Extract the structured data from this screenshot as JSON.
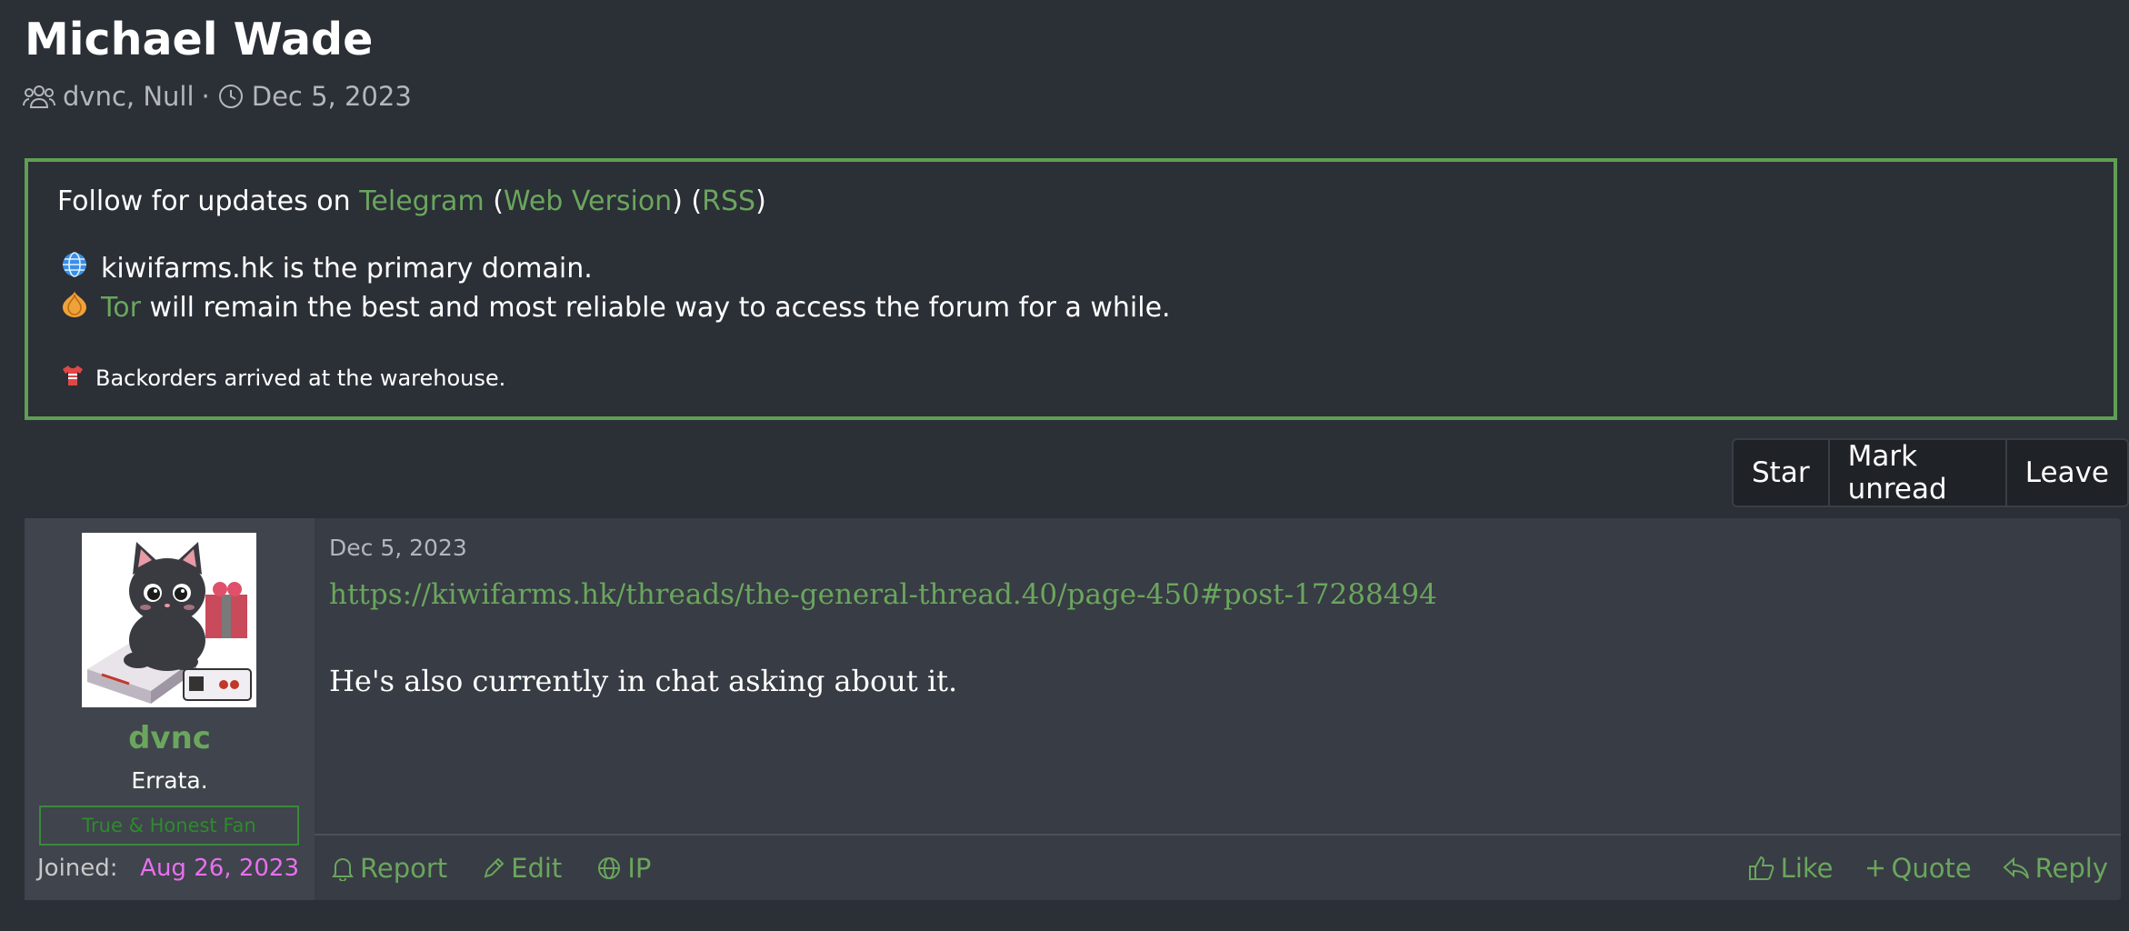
{
  "thread": {
    "title": "Michael Wade",
    "participants": "dvnc, Null",
    "separator": "·",
    "date": "Dec 5, 2023"
  },
  "notice": {
    "follow_prefix": "Follow for updates on ",
    "telegram": "Telegram",
    "open1": " (",
    "web_version": "Web Version",
    "mid": ") (",
    "rss": "RSS",
    "close": ")",
    "domain_text": "kiwifarms.hk is the primary domain.",
    "tor": "Tor",
    "tor_text": " will remain the best and most reliable way to access the forum for a while.",
    "backorders": "Backorders arrived at the warehouse."
  },
  "thread_actions": [
    "Star",
    "Mark unread",
    "Leave"
  ],
  "post": {
    "date": "Dec 5, 2023",
    "link": "https://kiwifarms.hk/threads/the-general-thread.40/page-450#post-17288494",
    "body": "He's also currently in chat asking about it.",
    "user": {
      "name": "dvnc",
      "title": "Errata.",
      "badge": "True & Honest Fan",
      "joined_label": "Joined:",
      "joined_value": "Aug 26, 2023"
    },
    "actions_left": {
      "report": "Report",
      "edit": "Edit",
      "ip": "IP"
    },
    "actions_right": {
      "like": "Like",
      "quote": "Quote",
      "reply": "Reply"
    }
  },
  "colors": {
    "accent_green": "#6aa65d",
    "background": "#2b2f36",
    "joined_date": "#e86ff0"
  }
}
